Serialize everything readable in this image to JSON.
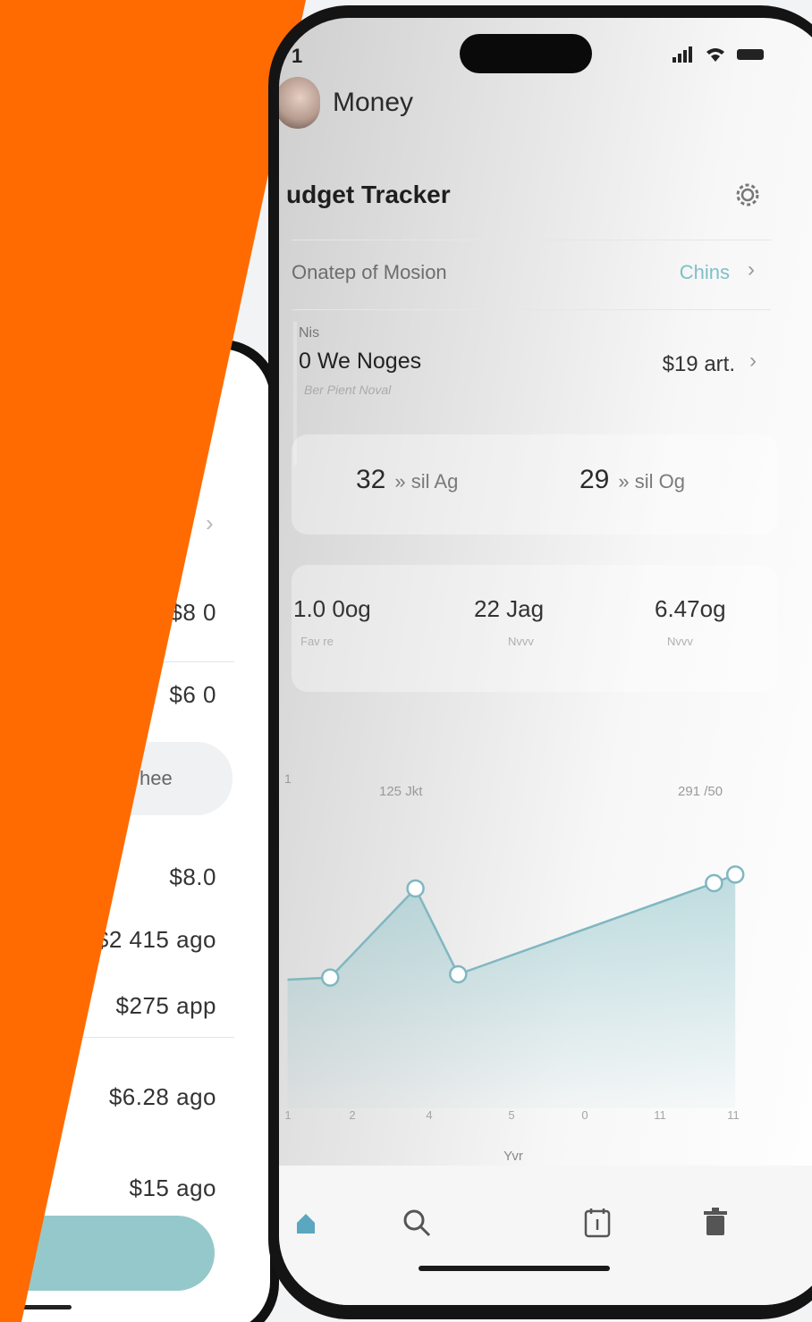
{
  "back_screen": {
    "values": [
      "$8 0",
      "$6 0",
      "$8.0",
      "$2 415 ago",
      "$275 app",
      "$6.28 ago",
      "$15 ago"
    ],
    "pill_text": "hee"
  },
  "status": {
    "time": "1",
    "icons": "signal wifi battery"
  },
  "app": {
    "title": "Money"
  },
  "page": {
    "title": "udget Tracker"
  },
  "rows": {
    "first": {
      "label": "Onatep of Mosion",
      "link": "Chins"
    },
    "item": {
      "tiny": "Nis",
      "name": "0 We Noges",
      "sub": "Ber Pient Noval",
      "amount": "$19 art."
    }
  },
  "stats_row1": [
    {
      "value": "32",
      "label": "» sil Ag"
    },
    {
      "value": "29",
      "label": "» sil Og"
    }
  ],
  "stats_row2": [
    {
      "value": "1.0 0og",
      "sub": "Fav re"
    },
    {
      "value": "22 Jag",
      "sub": "Nvvv"
    },
    {
      "value": "6.47og",
      "sub": "Nvvv"
    }
  ],
  "chart_data": {
    "type": "area",
    "annotations": [
      "1",
      "125 Jkt",
      "291 /50"
    ],
    "xlabel": "Yvr",
    "x_ticks": [
      "1",
      "2",
      "4",
      "5",
      "0",
      "11",
      "11"
    ],
    "points": [
      {
        "x": 1,
        "y": 120
      },
      {
        "x": 2,
        "y": 122
      },
      {
        "x": 4,
        "y": 205
      },
      {
        "x": 5,
        "y": 125
      },
      {
        "x": 11,
        "y": 210
      },
      {
        "x": 11.5,
        "y": 218
      }
    ],
    "ylim": [
      0,
      300
    ],
    "color": "#8cc3c9"
  },
  "tabbar": [
    "home-icon",
    "search-icon",
    "calendar-icon",
    "trash-icon"
  ],
  "colors": {
    "orange": "#ff6b00",
    "accent": "#7fbfcb",
    "button": "#95c8ca"
  }
}
